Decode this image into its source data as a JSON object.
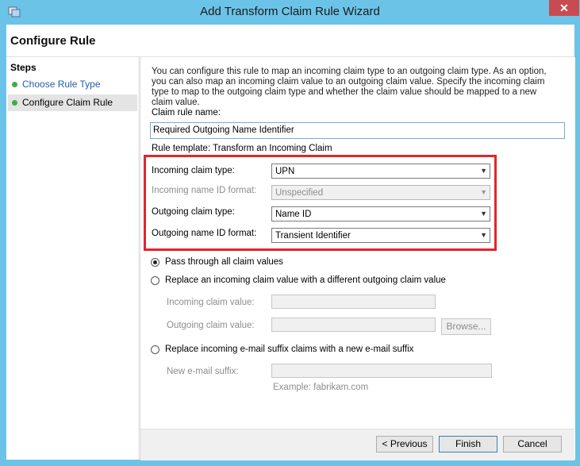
{
  "window": {
    "title": "Add Transform Claim Rule Wizard",
    "close_glyph": "✕"
  },
  "page_title": "Configure Rule",
  "steps": {
    "heading": "Steps",
    "items": [
      {
        "label": "Choose Rule Type"
      },
      {
        "label": "Configure Claim Rule"
      }
    ]
  },
  "intro_text": "You can configure this rule to map an incoming claim type to an outgoing claim type. As an option, you can also map an incoming claim value to an outgoing claim value. Specify the incoming claim type to map to the outgoing claim type and whether the claim value should be mapped to a new claim value.",
  "rule_name": {
    "label": "Claim rule name:",
    "value": "Required Outgoing Name Identifier"
  },
  "rule_template": "Rule template: Transform an Incoming Claim",
  "fields": {
    "incoming_claim_type": {
      "label": "Incoming claim type:",
      "value": "UPN"
    },
    "incoming_name_id_format": {
      "label": "Incoming name ID format:",
      "value": "Unspecified"
    },
    "outgoing_claim_type": {
      "label": "Outgoing claim type:",
      "value": "Name ID"
    },
    "outgoing_name_id_format": {
      "label": "Outgoing name ID format:",
      "value": "Transient Identifier"
    }
  },
  "options": {
    "pass_through": "Pass through all claim values",
    "replace_value": "Replace an incoming claim value with a different outgoing claim value",
    "incoming_claim_value_label": "Incoming claim value:",
    "outgoing_claim_value_label": "Outgoing claim value:",
    "browse_label": "Browse...",
    "replace_suffix": "Replace incoming e-mail suffix claims with a new e-mail suffix",
    "new_suffix_label": "New e-mail suffix:",
    "example_text": "Example: fabrikam.com"
  },
  "buttons": {
    "previous": "< Previous",
    "finish": "Finish",
    "cancel": "Cancel"
  },
  "colors": {
    "titlebar": "#6cc3e8",
    "highlight_box": "#e0262c",
    "step_done": "#3fae3f",
    "close": "#c74b50"
  }
}
